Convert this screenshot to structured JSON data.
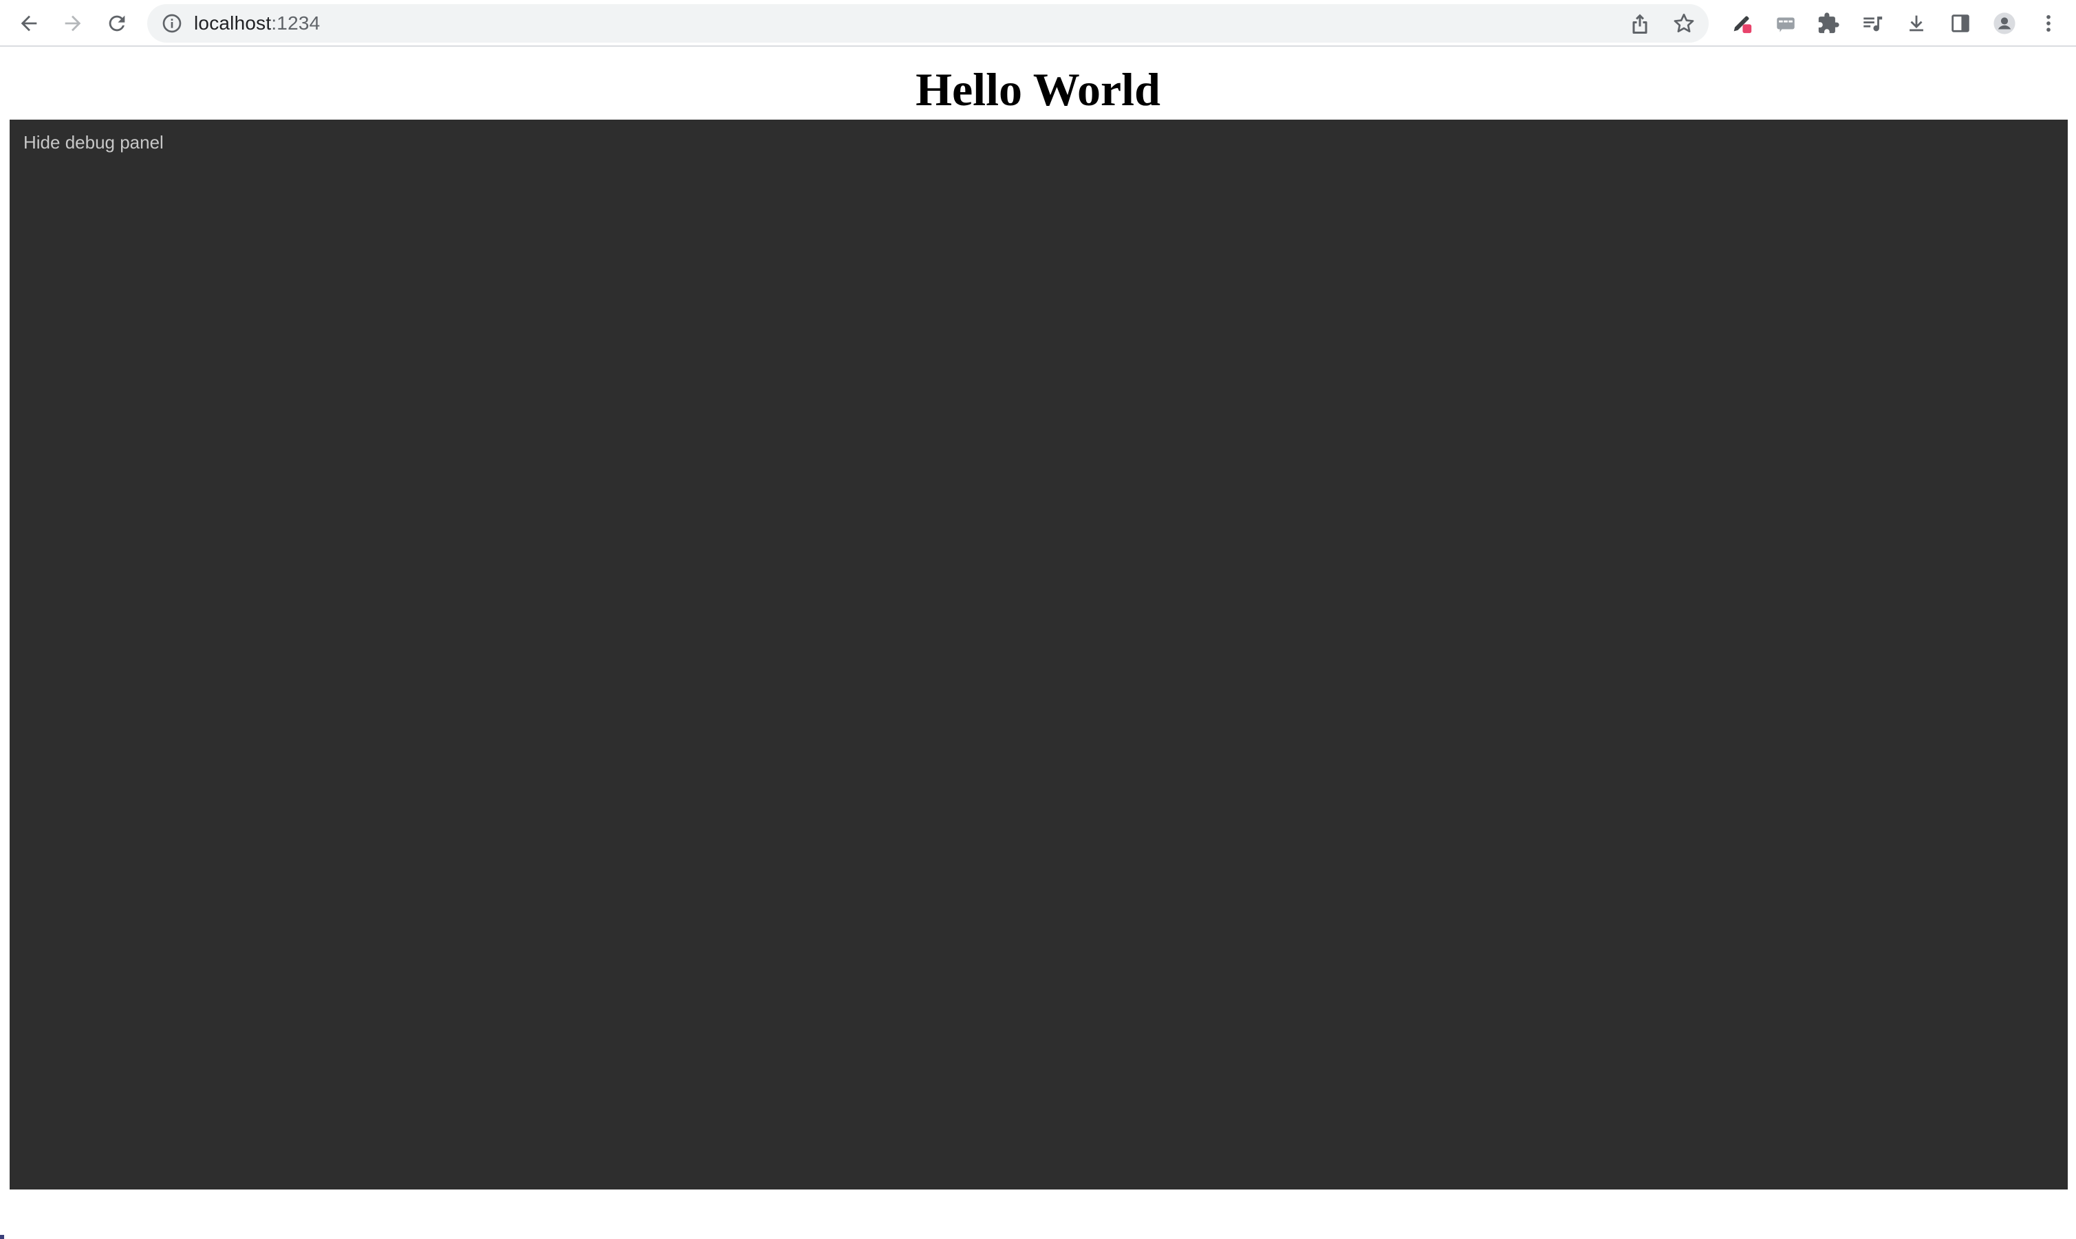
{
  "browser": {
    "url_host": "localhost",
    "url_port": ":1234",
    "colors": {
      "toolbar_icon": "#5f6368",
      "omnibox_bg": "#f1f3f4",
      "extension_badge": "#e8436b"
    },
    "icons": {
      "back": "arrow-left-icon",
      "forward": "arrow-right-icon",
      "reload": "reload-icon",
      "site_info": "info-icon",
      "share": "share-icon",
      "bookmark": "star-icon",
      "eyedropper_extension": "eyedropper-icon",
      "captions_extension": "captions-icon",
      "extensions": "puzzle-icon",
      "media": "media-queue-icon",
      "downloads": "download-icon",
      "side_panel": "side-panel-icon",
      "profile": "profile-avatar-icon",
      "menu": "more-vert-icon"
    }
  },
  "page": {
    "title": "Hello World",
    "debug_panel": {
      "toggle_label": "Hide debug panel",
      "background": "#2e2e2e"
    }
  }
}
